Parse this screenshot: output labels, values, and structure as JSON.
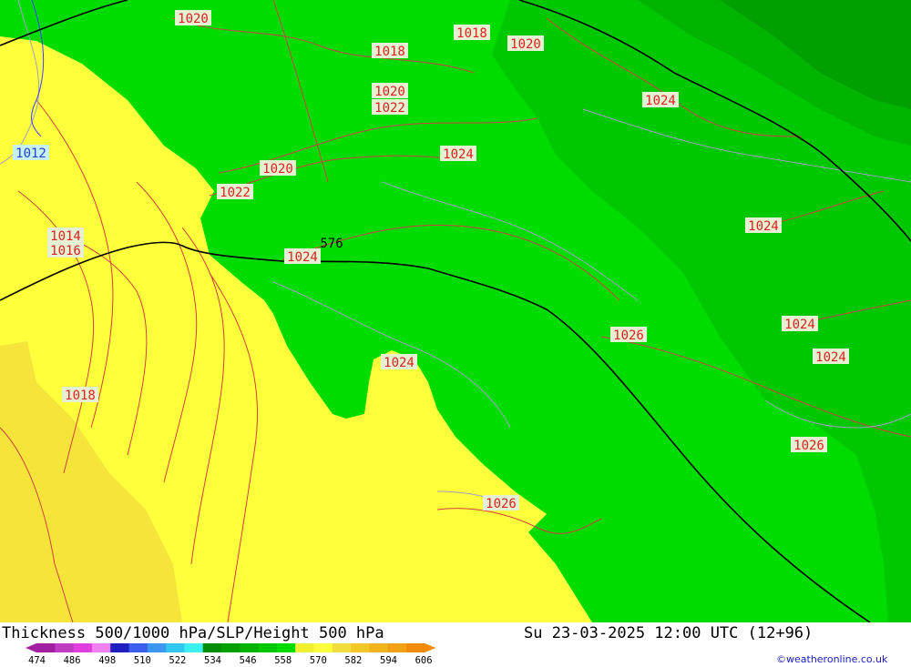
{
  "header": {
    "title": "Thickness 500/1000 hPa/SLP/Height 500 hPa",
    "valid_time": "Su 23-03-2025 12:00 UTC (12+96)"
  },
  "credit": "©weatheronline.co.uk",
  "legend": {
    "colors": [
      "#a020a0",
      "#c03cc0",
      "#e040e0",
      "#f080f0",
      "#2020c0",
      "#3a5ef0",
      "#3c96f0",
      "#32c8f0",
      "#3cf0f0",
      "#008c00",
      "#00a000",
      "#00b400",
      "#00c800",
      "#00dc00",
      "#f0f030",
      "#ffff3c",
      "#f0dc3c",
      "#f0c828",
      "#f0b41e",
      "#f0a014",
      "#f08c0a"
    ],
    "labels": [
      "474",
      "486",
      "498",
      "510",
      "522",
      "534",
      "546",
      "558",
      "570",
      "582",
      "594",
      "606"
    ]
  },
  "isobar_labels": [
    {
      "text": "1020",
      "color": "red"
    },
    {
      "text": "1018",
      "color": "red"
    },
    {
      "text": "1018",
      "color": "red"
    },
    {
      "text": "1020",
      "color": "red"
    },
    {
      "text": "1020",
      "color": "red"
    },
    {
      "text": "1022",
      "color": "red"
    },
    {
      "text": "1024",
      "color": "red"
    },
    {
      "text": "1012",
      "color": "blue"
    },
    {
      "text": "1024",
      "color": "red"
    },
    {
      "text": "1020",
      "color": "red"
    },
    {
      "text": "1022",
      "color": "red"
    },
    {
      "text": "1024",
      "color": "red"
    },
    {
      "text": "1014",
      "color": "red"
    },
    {
      "text": "1016",
      "color": "red"
    },
    {
      "text": "1024",
      "color": "red"
    },
    {
      "text": "576",
      "color": "black"
    },
    {
      "text": "1024",
      "color": "red"
    },
    {
      "text": "1026",
      "color": "red"
    },
    {
      "text": "1024",
      "color": "red"
    },
    {
      "text": "1024",
      "color": "red"
    },
    {
      "text": "1018",
      "color": "red"
    },
    {
      "text": "1026",
      "color": "red"
    },
    {
      "text": "1026",
      "color": "red"
    }
  ]
}
